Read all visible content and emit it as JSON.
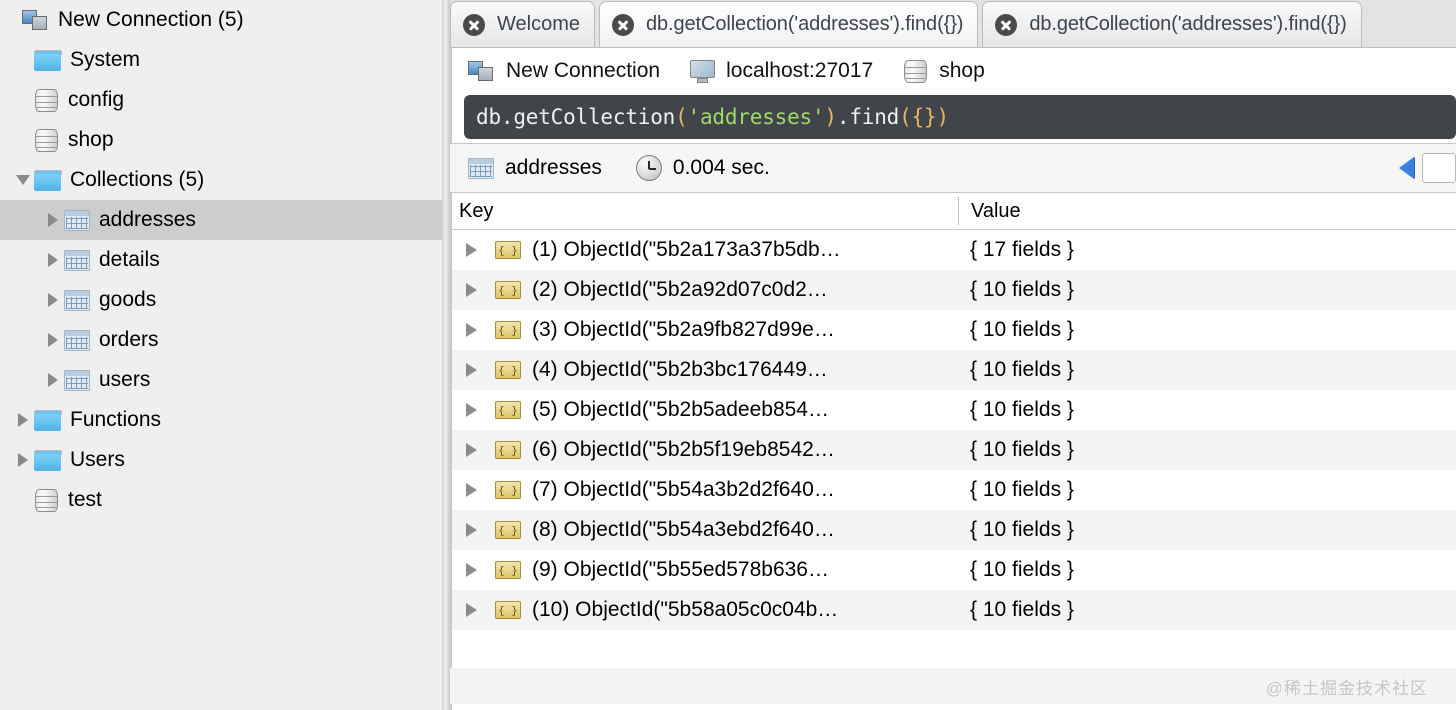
{
  "sidebar": {
    "items": [
      {
        "label": "New Connection (5)",
        "icon": "connection-icon",
        "twisty": "none",
        "indent": 0,
        "selected": false
      },
      {
        "label": "System",
        "icon": "folder-icon",
        "twisty": "none",
        "indent": 12,
        "selected": false
      },
      {
        "label": "config",
        "icon": "database-icon",
        "twisty": "none",
        "indent": 12,
        "selected": false
      },
      {
        "label": "shop",
        "icon": "database-icon",
        "twisty": "none",
        "indent": 12,
        "selected": false
      },
      {
        "label": "Collections (5)",
        "icon": "folder-icon",
        "twisty": "expanded",
        "indent": 12,
        "selected": false
      },
      {
        "label": "addresses",
        "icon": "collection-icon",
        "twisty": "collapsed",
        "indent": 42,
        "selected": true
      },
      {
        "label": "details",
        "icon": "collection-icon",
        "twisty": "collapsed",
        "indent": 42,
        "selected": false
      },
      {
        "label": "goods",
        "icon": "collection-icon",
        "twisty": "collapsed",
        "indent": 42,
        "selected": false
      },
      {
        "label": "orders",
        "icon": "collection-icon",
        "twisty": "collapsed",
        "indent": 42,
        "selected": false
      },
      {
        "label": "users",
        "icon": "collection-icon",
        "twisty": "collapsed",
        "indent": 42,
        "selected": false
      },
      {
        "label": "Functions",
        "icon": "folder-icon",
        "twisty": "collapsed",
        "indent": 12,
        "selected": false
      },
      {
        "label": "Users",
        "icon": "folder-icon",
        "twisty": "collapsed",
        "indent": 12,
        "selected": false
      },
      {
        "label": "test",
        "icon": "database-icon",
        "twisty": "none",
        "indent": 12,
        "selected": false
      }
    ]
  },
  "tabs": [
    {
      "label": "Welcome",
      "active": false,
      "close_icon": "close-icon"
    },
    {
      "label": "db.getCollection('addresses').find({})",
      "active": true,
      "close_icon": "close-icon"
    },
    {
      "label": "db.getCollection('addresses').find({})",
      "active": false,
      "close_icon": "close-icon"
    }
  ],
  "connection_bar": {
    "connection": {
      "label": "New Connection",
      "icon": "connection-icon"
    },
    "host": {
      "label": "localhost:27017",
      "icon": "monitor-icon"
    },
    "database": {
      "label": "shop",
      "icon": "database-icon"
    }
  },
  "editor": {
    "tokens": [
      {
        "text": "db.getCollection",
        "type": "plain"
      },
      {
        "text": "(",
        "type": "punct"
      },
      {
        "text": "'addresses'",
        "type": "string"
      },
      {
        "text": ")",
        "type": "punct"
      },
      {
        "text": ".find",
        "type": "plain"
      },
      {
        "text": "(",
        "type": "punct"
      },
      {
        "text": "{}",
        "type": "punct"
      },
      {
        "text": ")",
        "type": "punct"
      }
    ],
    "full_text": "db.getCollection('addresses').find({})",
    "colors": {
      "plain": "#f0f0f0",
      "punct": "#e8b563",
      "string": "#9fd96a",
      "background": "#414549"
    }
  },
  "result_bar": {
    "collection": "addresses",
    "collection_icon": "collection-icon",
    "time_icon": "clock-icon",
    "time": "0.004 sec.",
    "prev_page_icon": "prev-page-arrow-icon",
    "page_value": ""
  },
  "table": {
    "columns": [
      "Key",
      "Value"
    ],
    "rows": [
      {
        "key": "(1) ObjectId(\"5b2a173a37b5db…",
        "value": "{ 17 fields }"
      },
      {
        "key": "(2) ObjectId(\"5b2a92d07c0d2…",
        "value": "{ 10 fields }"
      },
      {
        "key": "(3) ObjectId(\"5b2a9fb827d99e…",
        "value": "{ 10 fields }"
      },
      {
        "key": "(4) ObjectId(\"5b2b3bc176449…",
        "value": "{ 10 fields }"
      },
      {
        "key": "(5) ObjectId(\"5b2b5adeeb854…",
        "value": "{ 10 fields }"
      },
      {
        "key": "(6) ObjectId(\"5b2b5f19eb8542…",
        "value": "{ 10 fields }"
      },
      {
        "key": "(7) ObjectId(\"5b54a3b2d2f640…",
        "value": "{ 10 fields }"
      },
      {
        "key": "(8) ObjectId(\"5b54a3ebd2f640…",
        "value": "{ 10 fields }"
      },
      {
        "key": "(9) ObjectId(\"5b55ed578b636…",
        "value": "{ 10 fields }"
      },
      {
        "key": "(10) ObjectId(\"5b58a05c0c04b…",
        "value": "{ 10 fields }"
      }
    ],
    "row_icon": "document-icon",
    "row_expand_icon": "expand-arrow-icon"
  },
  "watermark": "@稀土掘金技术社区"
}
